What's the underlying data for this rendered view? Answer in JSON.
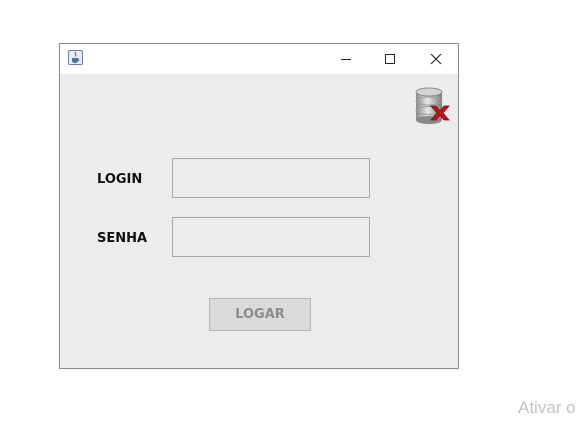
{
  "window": {
    "app_icon": "java-coffee-icon",
    "controls": {
      "minimize_icon": "minimize-icon",
      "maximize_icon": "maximize-icon",
      "close_icon": "close-icon"
    }
  },
  "status_icon": "database-disconnected-icon",
  "form": {
    "login_label": "LOGIN",
    "login_value": "",
    "senha_label": "SENHA",
    "senha_value": "",
    "submit_label": "LOGAR",
    "submit_enabled": false
  },
  "watermark": "Ativar o",
  "colors": {
    "window_bg": "#ececec",
    "titlebar_bg": "#ffffff",
    "button_disabled_text": "#8c8c8c",
    "status_error_red": "#c0141b"
  }
}
